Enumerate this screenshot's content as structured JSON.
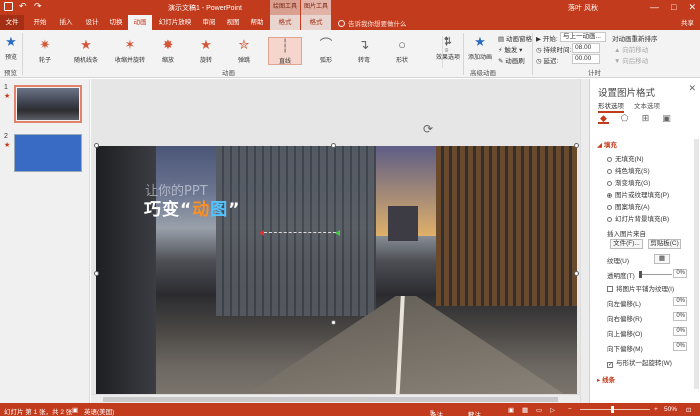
{
  "window": {
    "title": "演示文稿1 - PowerPoint",
    "context_tab_drawing": "绘图工具",
    "context_tab_picture": "图片工具",
    "user": "落叶 风秋",
    "controls": [
      "—",
      "□",
      "✕"
    ]
  },
  "ribbon_tabs": [
    "文件",
    "开始",
    "插入",
    "设计",
    "切换",
    "动画",
    "幻灯片放映",
    "审阅",
    "视图",
    "帮助",
    "格式",
    "格式"
  ],
  "active_tab": "动画",
  "tellme_placeholder": "告诉我你想要做什么",
  "share_label": "共享",
  "ribbon": {
    "preview": "预览",
    "preview_group": "预览",
    "animation_items": [
      "轮子",
      "随机线条",
      "收缩并旋转",
      "缩放",
      "旋转",
      "弹跳",
      "直线",
      "弧形",
      "转弯",
      "形状"
    ],
    "selected_animation": "直线",
    "effect_options": "效果选项",
    "animation_group": "动画",
    "add_animation": "添加动画",
    "animation_pane": "动画窗格",
    "trigger": "触发",
    "animation_painter": "动画刷",
    "advanced_group": "高级动画",
    "start_label": "开始:",
    "start_value": "与上一动画...",
    "duration_label": "持续时间:",
    "duration_value": "08.00",
    "delay_label": "延迟:",
    "delay_value": "00.00",
    "reorder_label": "对动画重新排序",
    "move_earlier": "向前移动",
    "move_later": "向后移动",
    "timing_group": "计时"
  },
  "thumbnails": [
    {
      "number": "1",
      "marker": "★"
    },
    {
      "number": "2",
      "marker": "★"
    }
  ],
  "slide": {
    "subtitle": "让你的PPT",
    "title_prefix": "巧变“",
    "title_highlight_1": "动",
    "title_highlight_2": "图",
    "title_suffix": "”"
  },
  "format_pane": {
    "title": "设置图片格式",
    "tab_shape": "形状选项",
    "tab_text": "文本选项",
    "fill_section": "填充",
    "fill_options": [
      "无填充(N)",
      "纯色填充(S)",
      "渐变填充(G)",
      "图片或纹理填充(P)",
      "图案填充(A)",
      "幻灯片背景填充(B)"
    ],
    "fill_selected": "图片或纹理填充(P)",
    "insert_from": "插入图片来自",
    "file_button": "文件(F)...",
    "clipboard_button": "剪贴板(C)",
    "texture_label": "纹理(U)",
    "transparency_label": "透明度(T)",
    "transparency_value": "0%",
    "tile_label": "将图片平铺为纹理(I)",
    "offset_left": "向左偏移(L)",
    "offset_right": "向右偏移(R)",
    "offset_up": "向上偏移(O)",
    "offset_down": "向下偏移(M)",
    "offset_value": "0%",
    "rotate_with_shape": "与形状一起旋转(W)",
    "line_section": "线条"
  },
  "status": {
    "slide_info": "幻灯片 第 1 张，共 2 张",
    "language": "英语(美国)",
    "notes": "备注",
    "comments": "批注",
    "zoom": "50%"
  }
}
